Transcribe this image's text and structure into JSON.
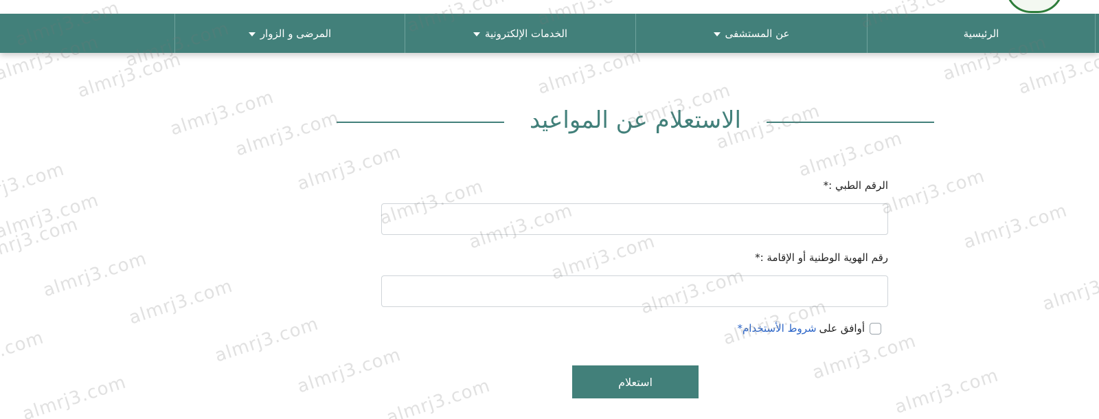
{
  "nav": {
    "items": [
      {
        "label": "الرئيسية",
        "has_dropdown": false
      },
      {
        "label": "عن المستشفى",
        "has_dropdown": true
      },
      {
        "label": "الخدمات الإلكترونية",
        "has_dropdown": true
      },
      {
        "label": "المرضى و الزوار",
        "has_dropdown": true
      }
    ]
  },
  "page": {
    "title": "الاستعلام عن المواعيد"
  },
  "form": {
    "medical_number_label": "الرقم الطبي :*",
    "medical_number_value": "",
    "national_id_label": "رقم الهوية الوطنية أو الإقامة :*",
    "national_id_value": "",
    "agree_prefix": "أوافق على",
    "terms_link": "شروط الأستخدام",
    "required_mark": "*",
    "submit_label": "استعلام"
  },
  "watermark": {
    "text": "almrj3.com"
  },
  "colors": {
    "primary": "#42807a",
    "link": "#2a64c8",
    "nav_text": "#ffffff",
    "logo_green": "#2e7d3a"
  }
}
